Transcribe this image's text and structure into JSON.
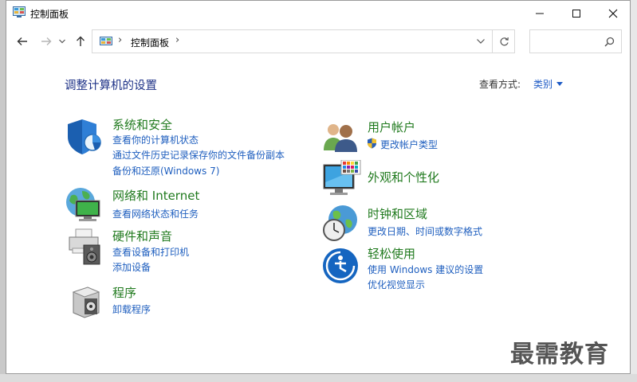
{
  "window": {
    "title": "控制面板"
  },
  "address": {
    "crumb": "控制面板",
    "chevron": "›"
  },
  "main": {
    "heading": "调整计算机的设置",
    "view_by_label": "查看方式:",
    "view_by_value": "类别"
  },
  "categories": {
    "system": {
      "title": "系统和安全",
      "links": [
        "查看你的计算机状态",
        "通过文件历史记录保存你的文件备份副本",
        "备份和还原(Windows 7)"
      ]
    },
    "network": {
      "title": "网络和 Internet",
      "links": [
        "查看网络状态和任务"
      ]
    },
    "hardware": {
      "title": "硬件和声音",
      "links": [
        "查看设备和打印机",
        "添加设备"
      ]
    },
    "programs": {
      "title": "程序",
      "links": [
        "卸载程序"
      ]
    },
    "users": {
      "title": "用户帐户",
      "links": [
        "更改帐户类型"
      ]
    },
    "appearance": {
      "title": "外观和个性化",
      "links": []
    },
    "clock": {
      "title": "时钟和区域",
      "links": [
        "更改日期、时间或数字格式"
      ]
    },
    "ease": {
      "title": "轻松使用",
      "links": [
        "使用 Windows 建议的设置",
        "优化视觉显示"
      ]
    }
  },
  "watermark": "最需教育",
  "colors": {
    "title_green": "#207a1e",
    "link_blue": "#1f5fbf",
    "heading_blue": "#1e3287"
  }
}
